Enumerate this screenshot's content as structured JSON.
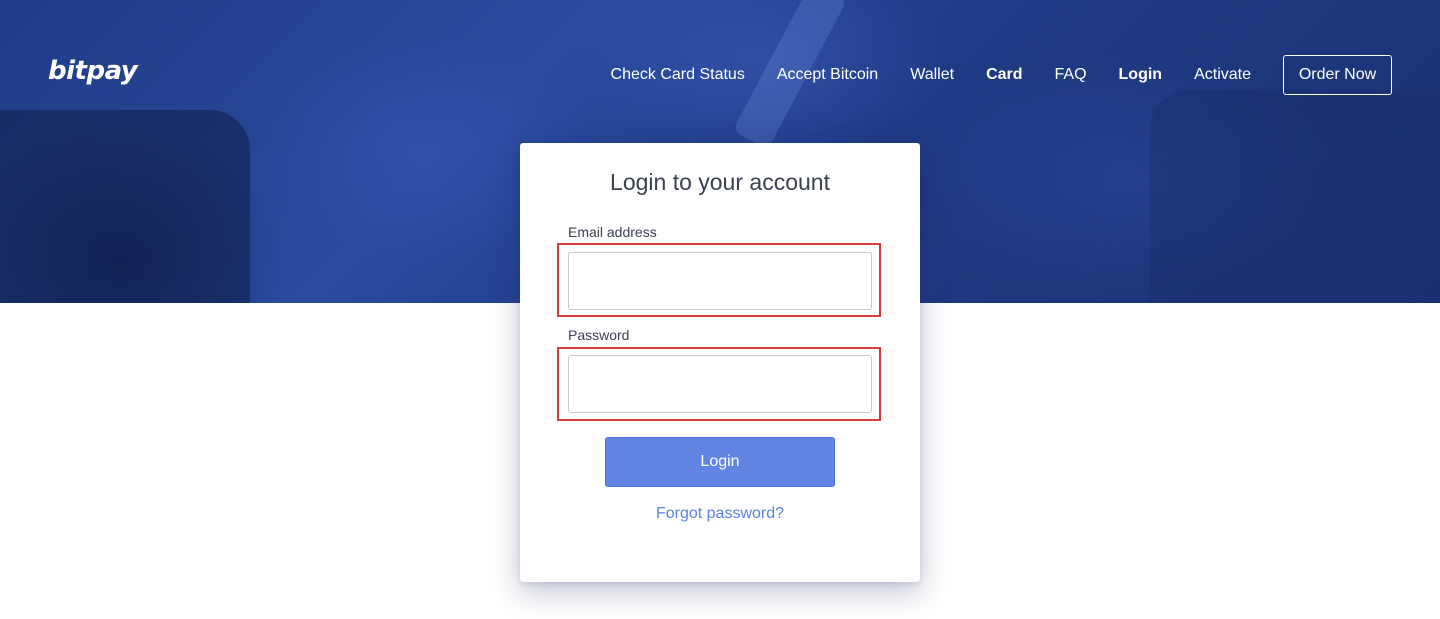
{
  "brand": {
    "logo_text": "bitpay"
  },
  "nav": {
    "items": [
      {
        "label": "Check Card Status",
        "bold": false
      },
      {
        "label": "Accept Bitcoin",
        "bold": false
      },
      {
        "label": "Wallet",
        "bold": false
      },
      {
        "label": "Card",
        "bold": true
      },
      {
        "label": "FAQ",
        "bold": false
      },
      {
        "label": "Login",
        "bold": true
      },
      {
        "label": "Activate",
        "bold": false
      }
    ],
    "cta_label": "Order Now"
  },
  "login_form": {
    "title": "Login to your account",
    "email_label": "Email address",
    "email_value": "",
    "email_placeholder": "",
    "password_label": "Password",
    "password_value": "",
    "password_placeholder": "",
    "submit_label": "Login",
    "forgot_label": "Forgot password?"
  },
  "colors": {
    "hero_blue": "#203c86",
    "primary_button": "#6285e3",
    "link": "#5b82e0",
    "highlight_red": "#d23d3d"
  }
}
